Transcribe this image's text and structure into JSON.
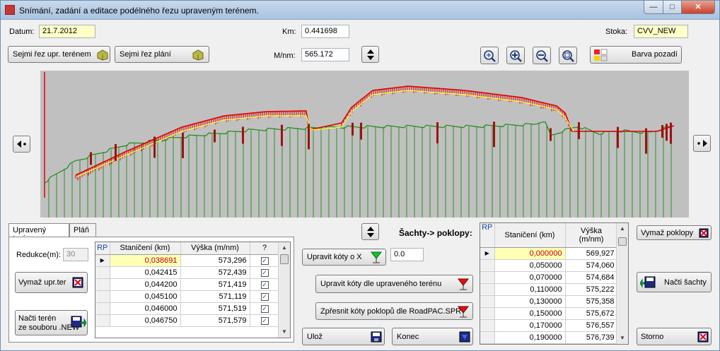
{
  "window": {
    "title": "Snímání, zadání a editace podélného řezu upraveným terénem."
  },
  "header": {
    "datum_label": "Datum:",
    "datum_value": "21.7.2012",
    "km_label": "Km:",
    "km_value": "0.441698",
    "mnm_label": "M/nm:",
    "mnm_value": "565.172",
    "stoka_label": "Stoka:",
    "stoka_value": "CVV_NEW"
  },
  "buttons": {
    "sejmi_rez_upr": "Sejmi řez  upr. terénem",
    "sejmi_rez_plani": "Sejmi řez  plání",
    "barva_pozadi": "Barva pozadí",
    "upravit_koty_x": "Upravit kóty  o X",
    "upravit_koty_teren": "Upravit kóty  dle upraveného terénu",
    "zpresnit_koty": "Zpřesnit kóty poklopů dle RoadPAC.SPR",
    "uloz": "Ulož",
    "konec": "Konec",
    "vymaz_upr_ter": "Vymaž upr.ter",
    "nacti_teren_1": "Načti terén",
    "nacti_teren_2": "ze souboru .NEW",
    "vymaz_poklopy": "Vymaž poklopy",
    "nacti_sachty": "Načti šachty",
    "storno": "Storno"
  },
  "offset_x_value": "0.0",
  "sachty_label": "Šachty-> poklopy:",
  "tabs": [
    {
      "label": "Upravený terén"
    },
    {
      "label": "Pláň"
    }
  ],
  "redukce": {
    "label": "Redukce(m):",
    "value": "30"
  },
  "terrain_table": {
    "headers": {
      "rp": "RP",
      "staniceni": "Staničení (km)",
      "vyska": "Výška (m/nm)",
      "q": "?"
    },
    "rows": [
      {
        "st": "0,038691",
        "v": "573,296"
      },
      {
        "st": "0,042415",
        "v": "572,439"
      },
      {
        "st": "0,044200",
        "v": "571,419"
      },
      {
        "st": "0,045100",
        "v": "571,119"
      },
      {
        "st": "0,046000",
        "v": "571,519"
      },
      {
        "st": "0,046750",
        "v": "571,579"
      }
    ]
  },
  "shafts_table": {
    "headers": {
      "rp": "RP",
      "staniceni": "Staničení (km)",
      "vyska_1": "Výška",
      "vyska_2": "(m/nm)"
    },
    "rows": [
      {
        "st": "0,000000",
        "v": "569,927"
      },
      {
        "st": "0,050000",
        "v": "574,060"
      },
      {
        "st": "0,070000",
        "v": "574,684"
      },
      {
        "st": "0,110000",
        "v": "575,222"
      },
      {
        "st": "0,130000",
        "v": "575,358"
      },
      {
        "st": "0,150000",
        "v": "575,672"
      },
      {
        "st": "0,170000",
        "v": "576,557"
      },
      {
        "st": "0,190000",
        "v": "576,739"
      }
    ]
  },
  "colors": {
    "graph_bg": "#c0c0c0",
    "terrain_line": "#1a8a1a",
    "profile_red": "#e00000",
    "profile_yellow": "#ffff33",
    "shaft_dark": "#a01010",
    "selection": "#ffffb5"
  },
  "icons": {
    "zoom": [
      "zoom-window-icon",
      "zoom-in-icon",
      "zoom-out-icon",
      "zoom-all-icon"
    ],
    "nav": [
      "scroll-left-icon",
      "scroll-right-icon",
      "scroll-updown-icon"
    ]
  }
}
